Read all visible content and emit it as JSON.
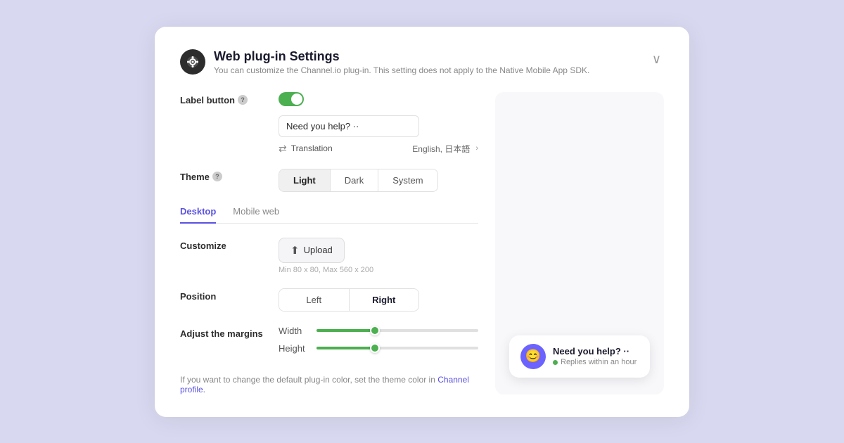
{
  "page": {
    "background": "#d8d8f0"
  },
  "card": {
    "header": {
      "title": "Web plug-in Settings",
      "subtitle": "You can customize the Channel.io plug-in. This setting does not apply to the Native Mobile App SDK.",
      "collapse_label": "collapse"
    },
    "label_button": {
      "label": "Label button",
      "toggle_on": true,
      "input_value": "Need you help? ··",
      "translation_label": "Translation",
      "translation_value": "English, 日本語",
      "translation_chevron": "›"
    },
    "theme": {
      "label": "Theme",
      "options": [
        "Light",
        "Dark",
        "System"
      ],
      "selected": "Light"
    },
    "tabs": [
      {
        "label": "Desktop",
        "active": true
      },
      {
        "label": "Mobile web",
        "active": false
      }
    ],
    "customize": {
      "label": "Customize",
      "upload_btn": "Upload",
      "hint": "Min 80 x 80, Max 560 x 200"
    },
    "position": {
      "label": "Position",
      "options": [
        "Left",
        "Right"
      ],
      "selected": "Right"
    },
    "adjust_margins": {
      "label": "Adjust the margins",
      "width_label": "Width",
      "height_label": "Height",
      "width_value": 35,
      "height_value": 35
    },
    "footer": {
      "text": "If you want to change the default plug-in color, set the theme color in",
      "link_text": "Channel profile.",
      "link_href": "#"
    }
  },
  "preview": {
    "title": "Need you help? ··",
    "subtitle": "Replies within an hour"
  }
}
